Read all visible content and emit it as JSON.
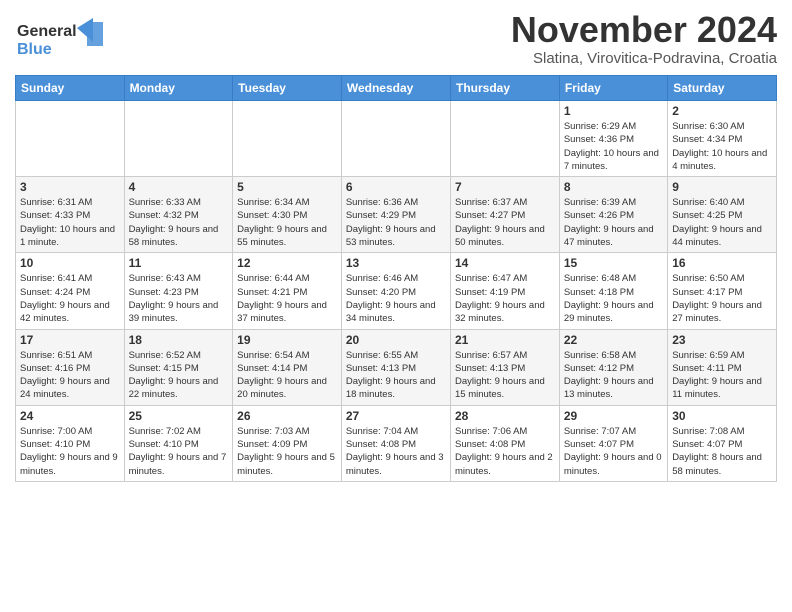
{
  "header": {
    "logo_line1": "General",
    "logo_line2": "Blue",
    "title": "November 2024",
    "subtitle": "Slatina, Virovitica-Podravina, Croatia"
  },
  "weekdays": [
    "Sunday",
    "Monday",
    "Tuesday",
    "Wednesday",
    "Thursday",
    "Friday",
    "Saturday"
  ],
  "weeks": [
    [
      {
        "day": "",
        "info": ""
      },
      {
        "day": "",
        "info": ""
      },
      {
        "day": "",
        "info": ""
      },
      {
        "day": "",
        "info": ""
      },
      {
        "day": "",
        "info": ""
      },
      {
        "day": "1",
        "info": "Sunrise: 6:29 AM\nSunset: 4:36 PM\nDaylight: 10 hours and 7 minutes."
      },
      {
        "day": "2",
        "info": "Sunrise: 6:30 AM\nSunset: 4:34 PM\nDaylight: 10 hours and 4 minutes."
      }
    ],
    [
      {
        "day": "3",
        "info": "Sunrise: 6:31 AM\nSunset: 4:33 PM\nDaylight: 10 hours and 1 minute."
      },
      {
        "day": "4",
        "info": "Sunrise: 6:33 AM\nSunset: 4:32 PM\nDaylight: 9 hours and 58 minutes."
      },
      {
        "day": "5",
        "info": "Sunrise: 6:34 AM\nSunset: 4:30 PM\nDaylight: 9 hours and 55 minutes."
      },
      {
        "day": "6",
        "info": "Sunrise: 6:36 AM\nSunset: 4:29 PM\nDaylight: 9 hours and 53 minutes."
      },
      {
        "day": "7",
        "info": "Sunrise: 6:37 AM\nSunset: 4:27 PM\nDaylight: 9 hours and 50 minutes."
      },
      {
        "day": "8",
        "info": "Sunrise: 6:39 AM\nSunset: 4:26 PM\nDaylight: 9 hours and 47 minutes."
      },
      {
        "day": "9",
        "info": "Sunrise: 6:40 AM\nSunset: 4:25 PM\nDaylight: 9 hours and 44 minutes."
      }
    ],
    [
      {
        "day": "10",
        "info": "Sunrise: 6:41 AM\nSunset: 4:24 PM\nDaylight: 9 hours and 42 minutes."
      },
      {
        "day": "11",
        "info": "Sunrise: 6:43 AM\nSunset: 4:23 PM\nDaylight: 9 hours and 39 minutes."
      },
      {
        "day": "12",
        "info": "Sunrise: 6:44 AM\nSunset: 4:21 PM\nDaylight: 9 hours and 37 minutes."
      },
      {
        "day": "13",
        "info": "Sunrise: 6:46 AM\nSunset: 4:20 PM\nDaylight: 9 hours and 34 minutes."
      },
      {
        "day": "14",
        "info": "Sunrise: 6:47 AM\nSunset: 4:19 PM\nDaylight: 9 hours and 32 minutes."
      },
      {
        "day": "15",
        "info": "Sunrise: 6:48 AM\nSunset: 4:18 PM\nDaylight: 9 hours and 29 minutes."
      },
      {
        "day": "16",
        "info": "Sunrise: 6:50 AM\nSunset: 4:17 PM\nDaylight: 9 hours and 27 minutes."
      }
    ],
    [
      {
        "day": "17",
        "info": "Sunrise: 6:51 AM\nSunset: 4:16 PM\nDaylight: 9 hours and 24 minutes."
      },
      {
        "day": "18",
        "info": "Sunrise: 6:52 AM\nSunset: 4:15 PM\nDaylight: 9 hours and 22 minutes."
      },
      {
        "day": "19",
        "info": "Sunrise: 6:54 AM\nSunset: 4:14 PM\nDaylight: 9 hours and 20 minutes."
      },
      {
        "day": "20",
        "info": "Sunrise: 6:55 AM\nSunset: 4:13 PM\nDaylight: 9 hours and 18 minutes."
      },
      {
        "day": "21",
        "info": "Sunrise: 6:57 AM\nSunset: 4:13 PM\nDaylight: 9 hours and 15 minutes."
      },
      {
        "day": "22",
        "info": "Sunrise: 6:58 AM\nSunset: 4:12 PM\nDaylight: 9 hours and 13 minutes."
      },
      {
        "day": "23",
        "info": "Sunrise: 6:59 AM\nSunset: 4:11 PM\nDaylight: 9 hours and 11 minutes."
      }
    ],
    [
      {
        "day": "24",
        "info": "Sunrise: 7:00 AM\nSunset: 4:10 PM\nDaylight: 9 hours and 9 minutes."
      },
      {
        "day": "25",
        "info": "Sunrise: 7:02 AM\nSunset: 4:10 PM\nDaylight: 9 hours and 7 minutes."
      },
      {
        "day": "26",
        "info": "Sunrise: 7:03 AM\nSunset: 4:09 PM\nDaylight: 9 hours and 5 minutes."
      },
      {
        "day": "27",
        "info": "Sunrise: 7:04 AM\nSunset: 4:08 PM\nDaylight: 9 hours and 3 minutes."
      },
      {
        "day": "28",
        "info": "Sunrise: 7:06 AM\nSunset: 4:08 PM\nDaylight: 9 hours and 2 minutes."
      },
      {
        "day": "29",
        "info": "Sunrise: 7:07 AM\nSunset: 4:07 PM\nDaylight: 9 hours and 0 minutes."
      },
      {
        "day": "30",
        "info": "Sunrise: 7:08 AM\nSunset: 4:07 PM\nDaylight: 8 hours and 58 minutes."
      }
    ]
  ]
}
